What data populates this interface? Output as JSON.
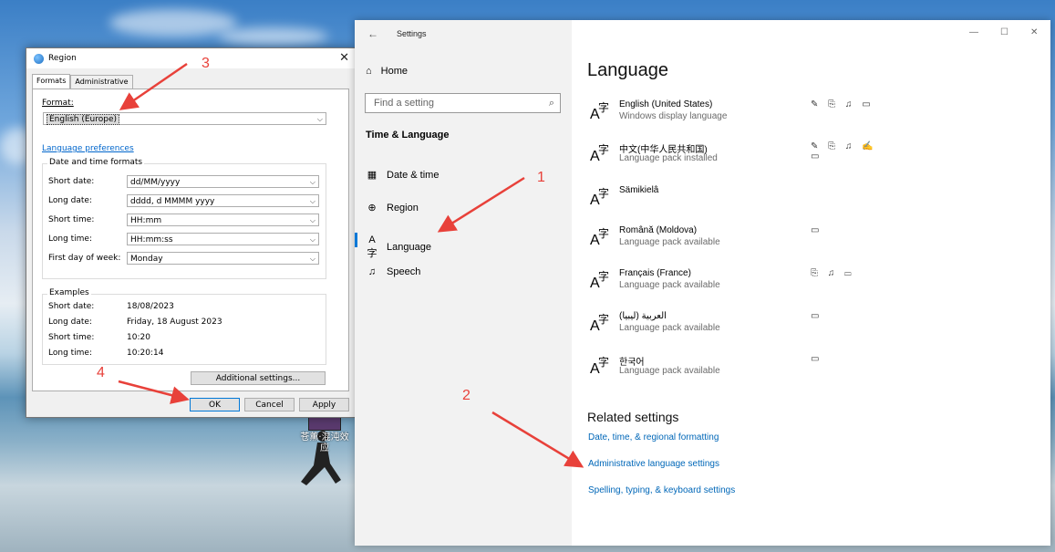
{
  "desktop": {
    "tray_label": "苍薰·混沌效应"
  },
  "region_dialog": {
    "title": "Region",
    "tabs": [
      "Formats",
      "Administrative"
    ],
    "format_label": "Format:",
    "format_value": "English (Europe)",
    "language_preferences_link": "Language preferences",
    "date_time_group": "Date and time formats",
    "fields": [
      {
        "label": "Short date:",
        "value": "dd/MM/yyyy"
      },
      {
        "label": "Long date:",
        "value": "dddd, d MMMM yyyy"
      },
      {
        "label": "Short time:",
        "value": "HH:mm"
      },
      {
        "label": "Long time:",
        "value": "HH:mm:ss"
      },
      {
        "label": "First day of week:",
        "value": "Monday"
      }
    ],
    "examples_group": "Examples",
    "examples": [
      {
        "label": "Short date:",
        "value": "18/08/2023"
      },
      {
        "label": "Long date:",
        "value": "Friday, 18 August 2023"
      },
      {
        "label": "Short time:",
        "value": "10:20"
      },
      {
        "label": "Long time:",
        "value": "10:20:14"
      }
    ],
    "additional_settings": "Additional settings...",
    "ok": "OK",
    "cancel": "Cancel",
    "apply": "Apply"
  },
  "settings": {
    "window_title": "Settings",
    "home": "Home",
    "search_placeholder": "Find a setting",
    "section": "Time & Language",
    "nav_items": [
      "Date & time",
      "Region",
      "Language",
      "Speech"
    ],
    "page_title": "Language",
    "languages": [
      {
        "name": "English (United States)",
        "sub": "Windows display language",
        "features": "✎ ⎘ ♫ ▭"
      },
      {
        "name": "中文(中华人民共和国)",
        "sub": "Language pack installed",
        "features": "✎ ⎘ ♫ ✍ ▭"
      },
      {
        "name": "Sämikielâ",
        "sub": "",
        "features": ""
      },
      {
        "name": "Română (Moldova)",
        "sub": "Language pack available",
        "features": "▭"
      },
      {
        "name": "Français (France)",
        "sub": "Language pack available",
        "features": "⎘ ♫ ▭"
      },
      {
        "name": "العربية (ليبيا)",
        "sub": "Language pack available",
        "features": "▭"
      },
      {
        "name": "한국어",
        "sub": "Language pack available",
        "features": "▭"
      }
    ],
    "related_title": "Related settings",
    "related_links": [
      "Date, time, & regional formatting",
      "Administrative language settings",
      "Spelling, typing, & keyboard settings"
    ]
  },
  "annotations": [
    "1",
    "2",
    "3",
    "4"
  ],
  "colors": {
    "accent": "#0078d7",
    "annotation": "#e8413a",
    "link": "#0067b8"
  }
}
